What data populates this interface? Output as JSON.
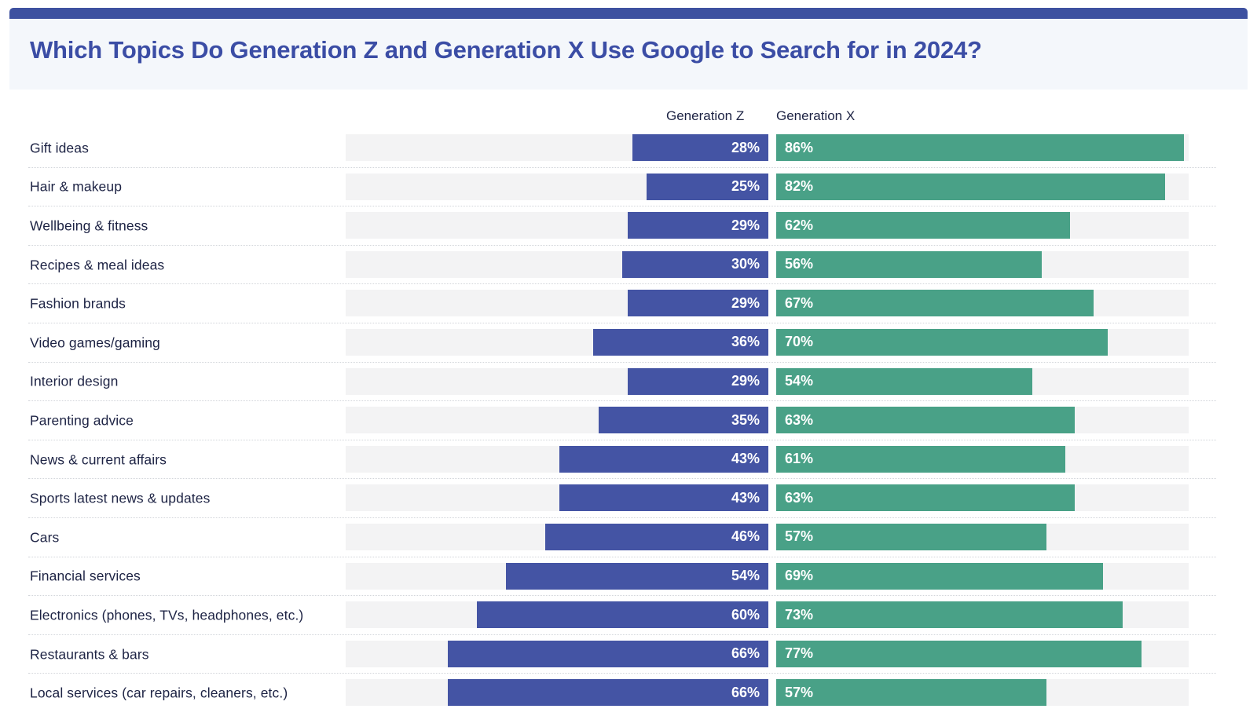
{
  "header": {
    "title": "Which Topics Do Generation Z and Generation X Use Google to Search for in 2024?",
    "accent_color": "#3e51a0",
    "panel_color": "#f4f7fb",
    "title_color": "#3b4da5"
  },
  "legend": {
    "series_z_label": "Generation Z",
    "series_x_label": "Generation X",
    "series_z_color": "#4454a4",
    "series_x_color": "#49a187",
    "track_color": "#f3f3f4"
  },
  "chart_data": {
    "type": "bar",
    "orientation": "horizontal",
    "layout": "diverging-paired",
    "title": "Which Topics Do Generation Z and Generation X Use Google to Search for in 2024?",
    "xlabel": "",
    "ylabel": "",
    "value_suffix": "%",
    "xlim": [
      0,
      87
    ],
    "grid": false,
    "legend_position": "top",
    "categories": [
      "Gift ideas",
      "Hair & makeup",
      "Wellbeing & fitness",
      "Recipes & meal ideas",
      "Fashion brands",
      "Video games/gaming",
      "Interior design",
      "Parenting advice",
      "News & current affairs",
      "Sports latest news & updates",
      "Cars",
      "Financial services",
      "Electronics (phones, TVs, headphones, etc.)",
      "Restaurants & bars",
      "Local services (car repairs, cleaners, etc.)"
    ],
    "series": [
      {
        "name": "Generation Z",
        "color": "#4454a4",
        "align": "right",
        "values": [
          28,
          25,
          29,
          30,
          29,
          36,
          29,
          35,
          43,
          43,
          46,
          54,
          60,
          66,
          66
        ],
        "labels": [
          "28%",
          "25%",
          "29%",
          "30%",
          "29%",
          "36%",
          "29%",
          "35%",
          "43%",
          "43%",
          "46%",
          "54%",
          "60%",
          "66%",
          "66%"
        ]
      },
      {
        "name": "Generation X",
        "color": "#49a187",
        "align": "left",
        "values": [
          86,
          82,
          62,
          56,
          67,
          70,
          54,
          63,
          61,
          63,
          57,
          69,
          73,
          77,
          57
        ],
        "labels": [
          "86%",
          "82%",
          "62%",
          "56%",
          "67%",
          "70%",
          "54%",
          "63%",
          "61%",
          "63%",
          "57%",
          "69%",
          "73%",
          "77%",
          "57%"
        ]
      }
    ]
  }
}
